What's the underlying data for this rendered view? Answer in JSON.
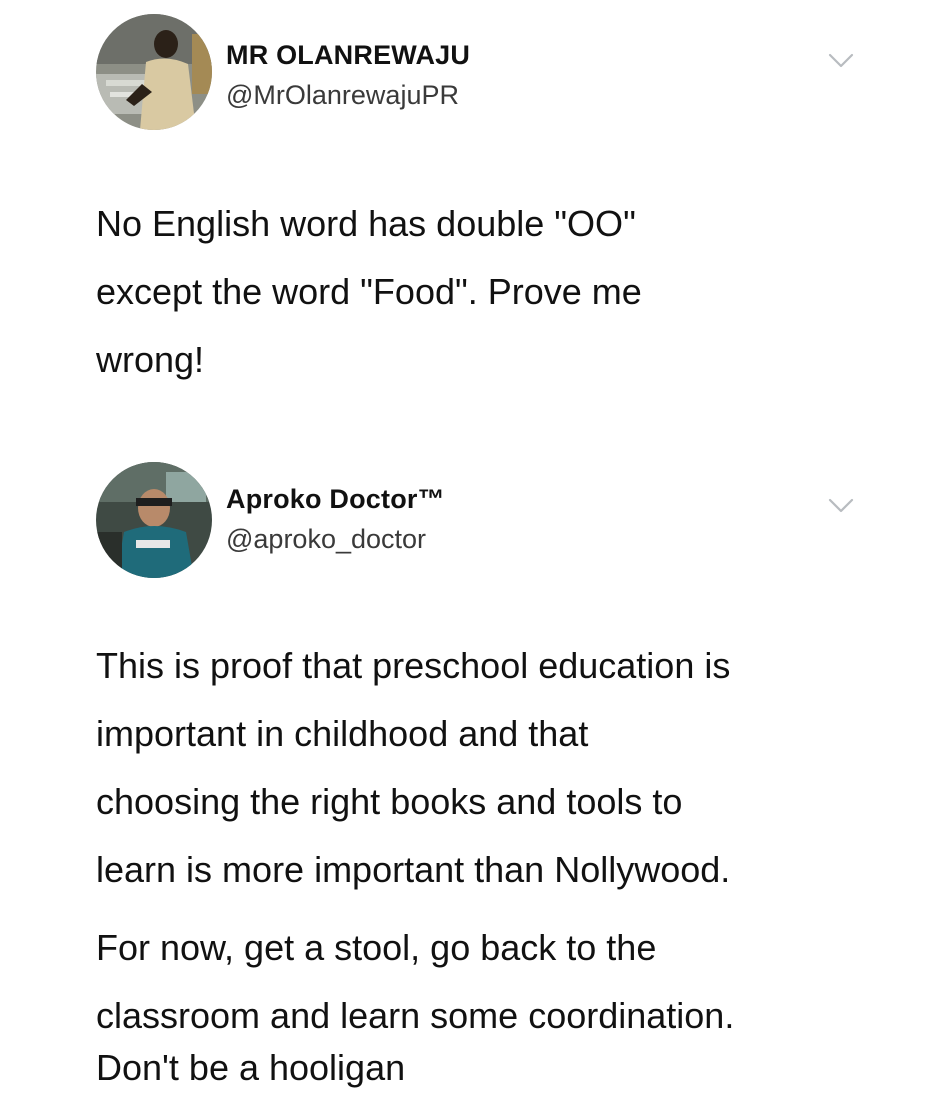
{
  "tweet1": {
    "display_name": "MR OLANREWAJU",
    "handle": "@MrOlanrewajuPR",
    "text_lines": [
      "No English word has double \"OO\"",
      "except the word \"Food\".  Prove me",
      "wrong!"
    ],
    "menu_icon": "chevron-down-icon"
  },
  "tweet2": {
    "display_name": "Aproko Doctor™",
    "handle": "@aproko_doctor",
    "paragraph1_lines": [
      "This is proof that preschool education is",
      "important in childhood and that",
      "choosing the right books and tools to",
      "learn is more important than Nollywood."
    ],
    "paragraph2_lines": [
      "For now, get a stool, go back to the",
      "classroom and learn some coordination."
    ],
    "paragraph3_lines": [
      "Don't be a hooligan"
    ],
    "menu_icon": "chevron-down-icon"
  },
  "colors": {
    "text": "#111111",
    "handle": "#3a3a3a",
    "chevron": "#b8bcc0",
    "background": "#ffffff"
  }
}
